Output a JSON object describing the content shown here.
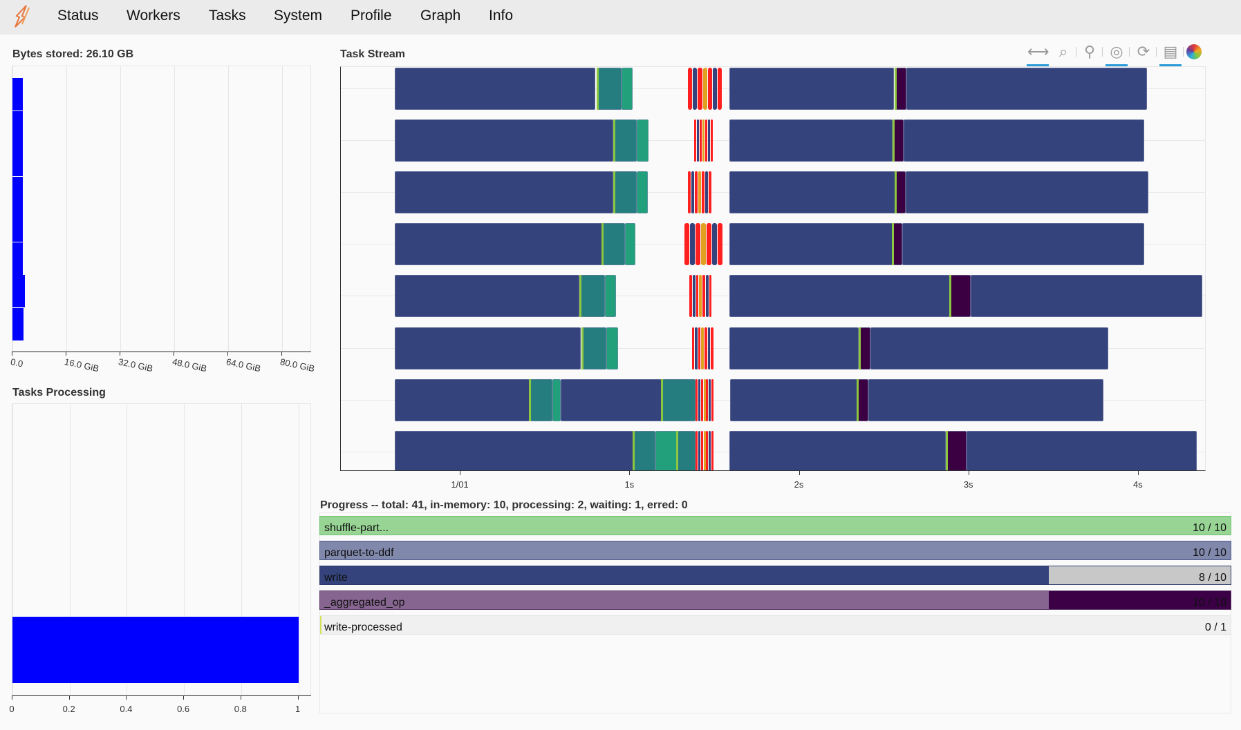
{
  "nav": {
    "items": [
      "Status",
      "Workers",
      "Tasks",
      "System",
      "Profile",
      "Graph",
      "Info"
    ]
  },
  "bytes_stored": {
    "title": "Bytes stored: 26.10 GB",
    "bar_color": "#0000ff",
    "xlim_gib": [
      0,
      88.9
    ],
    "ticks": [
      {
        "v": 0,
        "label": "0.0"
      },
      {
        "v": 16,
        "label": "16.0 GiB"
      },
      {
        "v": 32,
        "label": "32.0 GiB"
      },
      {
        "v": 48,
        "label": "48.0 GiB"
      },
      {
        "v": 64,
        "label": "64.0 GiB"
      },
      {
        "v": 80,
        "label": "80.0 GiB"
      }
    ],
    "values_gib": [
      3.05,
      3.05,
      3.0,
      3.0,
      3.05,
      3.0,
      3.7,
      3.3
    ]
  },
  "tasks_processing": {
    "title": "Tasks Processing",
    "bar_color": "#0000ff",
    "xlim": [
      0,
      1.047
    ],
    "ticks": [
      {
        "v": 0,
        "label": "0"
      },
      {
        "v": 0.2,
        "label": "0.2"
      },
      {
        "v": 0.4,
        "label": "0.4"
      },
      {
        "v": 0.6,
        "label": "0.6"
      },
      {
        "v": 0.8,
        "label": "0.8"
      },
      {
        "v": 1,
        "label": "1"
      }
    ],
    "values": [
      1
    ]
  },
  "task_stream": {
    "title": "Task Stream",
    "xlim_s": [
      -0.706,
      4.4
    ],
    "ticks": [
      {
        "v": 0,
        "label": "1/01"
      },
      {
        "v": 1,
        "label": "1s"
      },
      {
        "v": 2,
        "label": "2s"
      },
      {
        "v": 3,
        "label": "3s"
      },
      {
        "v": 4,
        "label": "4s"
      }
    ],
    "colors": {
      "read": "#35437c",
      "shuffle": "#257d7f",
      "shuffle2": "#22a07c",
      "agg": "#3b0042",
      "lime": "#8dc63f",
      "red": "#ff1f1f"
    },
    "rows": [
      {
        "segs": [
          [
            -0.388,
            0.794,
            "read"
          ],
          [
            0.813,
            0.95,
            "shuffle"
          ],
          [
            0.95,
            1.014,
            "shuffle2"
          ],
          [
            2.57,
            2.631,
            "agg"
          ],
          [
            1.584,
            2.556,
            "read"
          ],
          [
            2.631,
            4.051,
            "read"
          ]
        ],
        "cluster": [
          1.341,
          1.547
        ]
      },
      {
        "segs": [
          [
            -0.388,
            0.902,
            "read"
          ],
          [
            0.911,
            1.04,
            "shuffle"
          ],
          [
            1.04,
            1.107,
            "shuffle2"
          ],
          [
            1.584,
            2.547,
            "read"
          ],
          [
            2.556,
            2.612,
            "agg"
          ],
          [
            2.612,
            4.033,
            "read"
          ]
        ],
        "cluster": [
          1.379,
          1.491
        ]
      },
      {
        "segs": [
          [
            -0.388,
            0.902,
            "read"
          ],
          [
            0.911,
            1.04,
            "shuffle"
          ],
          [
            1.04,
            1.103,
            "shuffle2"
          ],
          [
            1.584,
            2.565,
            "read"
          ],
          [
            2.57,
            2.626,
            "agg"
          ],
          [
            2.626,
            4.056,
            "read"
          ]
        ],
        "cluster": [
          1.341,
          1.486
        ]
      },
      {
        "segs": [
          [
            -0.388,
            0.836,
            "read"
          ],
          [
            0.841,
            0.97,
            "shuffle"
          ],
          [
            0.97,
            1.033,
            "shuffle2"
          ],
          [
            1.584,
            2.547,
            "read"
          ],
          [
            2.551,
            2.607,
            "agg"
          ],
          [
            2.607,
            4.033,
            "read"
          ]
        ],
        "cluster": [
          1.322,
          1.551
        ]
      },
      {
        "segs": [
          [
            -0.388,
            0.701,
            "read"
          ],
          [
            0.71,
            0.85,
            "shuffle"
          ],
          [
            0.85,
            0.916,
            "shuffle2"
          ],
          [
            1.584,
            2.888,
            "read"
          ],
          [
            2.893,
            3.009,
            "agg"
          ],
          [
            3.009,
            4.374,
            "read"
          ]
        ],
        "cluster": [
          1.35,
          1.486
        ]
      },
      {
        "segs": [
          [
            -0.388,
            0.71,
            "read"
          ],
          [
            0.72,
            0.86,
            "shuffle"
          ],
          [
            0.86,
            0.93,
            "shuffle2"
          ],
          [
            1.584,
            2.35,
            "read"
          ],
          [
            2.355,
            2.416,
            "agg"
          ],
          [
            2.416,
            3.822,
            "read"
          ]
        ],
        "cluster": [
          1.364,
          1.495
        ]
      },
      {
        "segs": [
          [
            -0.388,
            0.407,
            "read"
          ],
          [
            0.411,
            0.54,
            "shuffle"
          ],
          [
            0.54,
            0.589,
            "shuffle2"
          ],
          [
            0.589,
            1.187,
            "read"
          ],
          [
            1.192,
            1.388,
            "shuffle"
          ],
          [
            1.589,
            2.341,
            "read"
          ],
          [
            2.346,
            2.407,
            "agg"
          ],
          [
            2.407,
            3.794,
            "read"
          ]
        ],
        "cluster": [
          1.388,
          1.495
        ]
      },
      {
        "segs": [
          [
            -0.388,
            1.019,
            "read"
          ],
          [
            1.023,
            1.15,
            "shuffle"
          ],
          [
            1.15,
            1.28,
            "shuffle2"
          ],
          [
            1.28,
            1.388,
            "shuffle"
          ],
          [
            1.584,
            2.864,
            "read"
          ],
          [
            2.869,
            2.986,
            "agg"
          ],
          [
            2.986,
            4.341,
            "read"
          ]
        ],
        "cluster": [
          1.388,
          1.495
        ]
      }
    ]
  },
  "toolbar": {
    "tools": [
      {
        "icon": "pan-icon",
        "glyph": "⟷",
        "active": true
      },
      {
        "icon": "box-zoom-icon",
        "glyph": "⌕",
        "active": false
      },
      {
        "icon": "wheel-zoom-icon",
        "glyph": "⚲",
        "active": false
      },
      {
        "icon": "wheel-zoom-plus-icon",
        "glyph": "◎",
        "active": true
      },
      {
        "icon": "reset-icon",
        "glyph": "⟳",
        "active": false
      },
      {
        "icon": "hover-icon",
        "glyph": "▤",
        "active": true
      },
      {
        "icon": "bokeh-logo-icon",
        "glyph": "",
        "active": false
      }
    ]
  },
  "progress": {
    "title": "Progress -- total: 41, in-memory: 10, processing: 2, waiting: 1, erred: 0",
    "rows": [
      {
        "name": "shuffle-part...",
        "count": "10 / 10",
        "fraction": 1.0,
        "fill": "#98d595",
        "border": "#6cc46a",
        "rest": "#98d595"
      },
      {
        "name": "parquet-to-ddf",
        "count": "10 / 10",
        "fraction": 1.0,
        "fill": "#8088ab",
        "border": "#505b8f",
        "rest": "#8088ab"
      },
      {
        "name": "write",
        "count": "8 / 10",
        "fraction": 0.8,
        "fill": "#34437c",
        "border": "#2b3868",
        "rest": "#c8c8c8"
      },
      {
        "name": "_aggregated_op",
        "count": "10 / 10",
        "fraction": 0.8,
        "fill": "#866590",
        "border": "#5e3a6a",
        "rest": "#3b0046"
      },
      {
        "name": "write-processed",
        "count": "0 / 1",
        "fraction": 0.0,
        "fill": "#f0f0f0",
        "border": "#e4e4e4",
        "rest": "#f0f0f0"
      }
    ]
  }
}
